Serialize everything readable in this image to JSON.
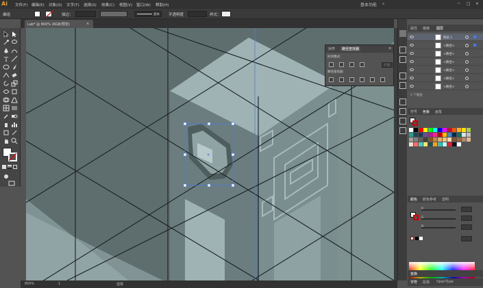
{
  "app": {
    "logo": "Ai",
    "menus": [
      "文件(F)",
      "编辑(E)",
      "对象(O)",
      "文字(T)",
      "选择(S)",
      "效果(C)",
      "视图(V)",
      "窗口(W)",
      "帮助(H)"
    ],
    "workspace_label": "基本功能"
  },
  "control_bar": {
    "object_type": "编组",
    "stroke_label": "描边：",
    "stroke_style": "基本",
    "opacity_label": "不透明度",
    "style_label": "样式："
  },
  "document_tab": {
    "title": "Lab* @ 800% (RGB/预览)",
    "close": "×"
  },
  "float_panel": {
    "tabs": [
      "对齐",
      "路径查找器"
    ],
    "shape_modes_label": "形状模式：",
    "pathfinder_label": "路径查找器：",
    "expand_label": "扩展"
  },
  "status_bar": {
    "zoom": "800%",
    "artboard": "1",
    "tool": "选择"
  },
  "panels": {
    "layers_tabs": [
      "属性",
      "链接",
      "图层"
    ],
    "layers": [
      {
        "name": "图层 1"
      },
      {
        "name": "<路径>"
      },
      {
        "name": "<路径>"
      },
      {
        "name": "<路径>"
      },
      {
        "name": "<路径>"
      },
      {
        "name": "<路径>"
      },
      {
        "name": "<路径>"
      }
    ],
    "layers_footer": "1 个图层",
    "swatch_tabs": [
      "符号",
      "色板",
      "画笔"
    ],
    "color_tabs": [
      "颜色",
      "颜色参考",
      "透明"
    ],
    "color_channels": [
      "R",
      "G",
      "B"
    ],
    "bottom_tabs": [
      "变换"
    ],
    "type_tabs": [
      "字符",
      "段落",
      "OpenType"
    ]
  },
  "colors": {
    "canvas_bg": "#5e6e6f",
    "pillar_front": "#6b7d7e",
    "pillar_top": "#8fa2a3",
    "pillar_side": "#778b8c",
    "light_face": "#9fb3b4",
    "selection": "#4a7be6",
    "ui_dark": "#323232"
  },
  "swatches": [
    "#ffffff",
    "#000000",
    "#ff0000",
    "#ffff00",
    "#00ff00",
    "#00ffff",
    "#0000ff",
    "#ff00ff",
    "#c8102e",
    "#e85d04",
    "#f7b32b",
    "#fce205",
    "#a7c957",
    "#2a9d8f",
    "#264653",
    "#1d3557",
    "#6a4c93",
    "#b5179e",
    "#f72585",
    "#d00000",
    "#ffba08",
    "#3f88c5",
    "#032b43",
    "#136f63",
    "#e0e0e0",
    "#c0c0c0",
    "#a0a0a0",
    "#808080",
    "#606060",
    "#404040",
    "#8d5524",
    "#c68642",
    "#e0ac69",
    "#f1c27d",
    "#ffdbac",
    "#7f5539",
    "#9c6644",
    "#b08968",
    "#ddb892",
    "#ede0d4",
    "#ff6b6b",
    "#4ecdc4",
    "#ffe66d",
    "#1a535c",
    "#ff9f1c",
    "#2ec4b6",
    "#cbf3f0",
    "#e71d36",
    "#011627",
    "#fdfffc"
  ]
}
